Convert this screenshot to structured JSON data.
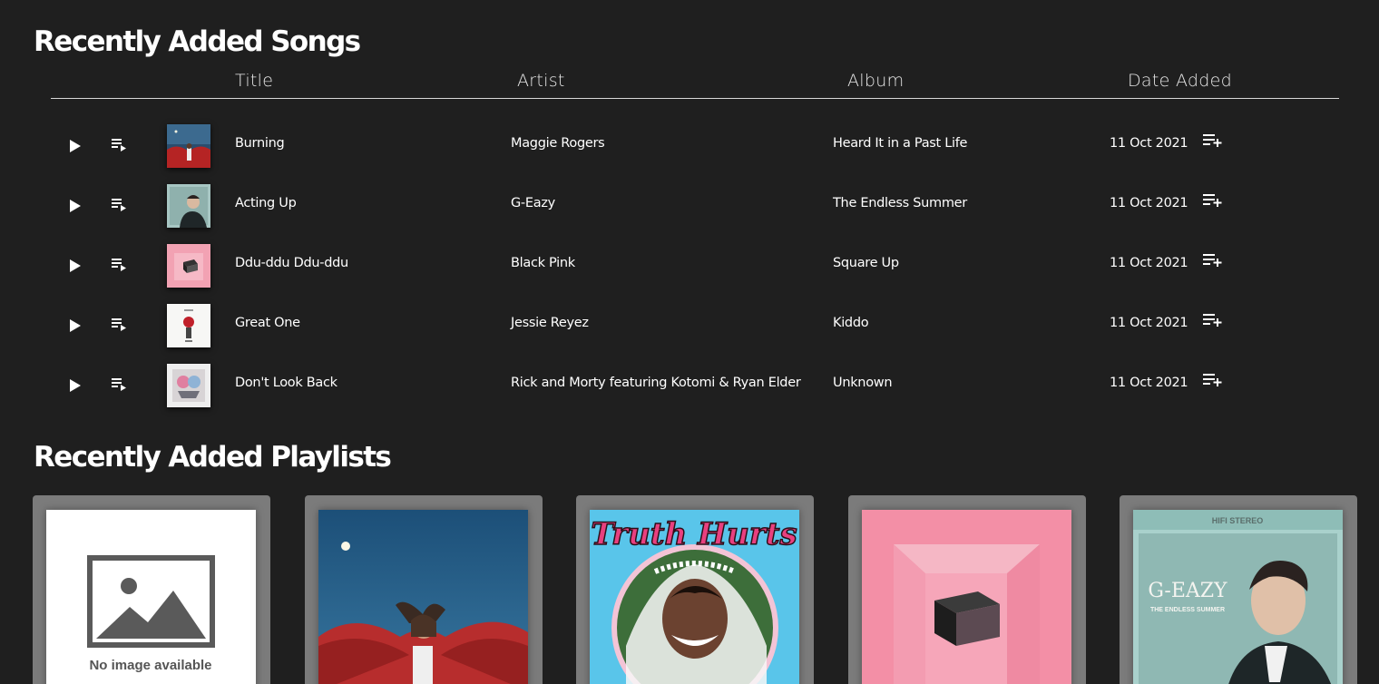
{
  "songs_section": {
    "title": "Recently Added Songs",
    "columns": [
      "Title",
      "Artist",
      "Album",
      "Date Added"
    ],
    "rows": [
      {
        "title": "Burning",
        "artist": "Maggie Rogers",
        "album": "Heard It in a Past Life",
        "date": "11 Oct 2021",
        "cover": "heard-it-cover"
      },
      {
        "title": "Acting Up",
        "artist": "G-Eazy",
        "album": "The Endless Summer",
        "date": "11 Oct 2021",
        "cover": "endless-summer-cover"
      },
      {
        "title": "Ddu-ddu Ddu-ddu",
        "artist": "Black Pink",
        "album": "Square Up",
        "date": "11 Oct 2021",
        "cover": "square-up-cover"
      },
      {
        "title": "Great One",
        "artist": "Jessie Reyez",
        "album": "Kiddo",
        "date": "11 Oct 2021",
        "cover": "kiddo-cover"
      },
      {
        "title": "Don't Look Back",
        "artist": "Rick and Morty featuring Kotomi & Ryan Elder",
        "album": "Unknown",
        "date": "11 Oct 2021",
        "cover": "rick-morty-cover"
      }
    ]
  },
  "playlists_section": {
    "title": "Recently Added Playlists",
    "cards": [
      {
        "image": "no-image-placeholder",
        "placeholder_text": "No image available"
      },
      {
        "image": "maggie-rogers-cover"
      },
      {
        "image": "truth-hurts-cover",
        "cover_text": "Truth Hurts"
      },
      {
        "image": "square-up-cover"
      },
      {
        "image": "g-eazy-cover",
        "cover_text": "G-EAZY",
        "cover_subtext": "THE ENDLESS SUMMER",
        "cover_top": "HIFI STEREO"
      }
    ]
  },
  "colors": {
    "background": "#1f1f1f",
    "card": "#7b7b7b",
    "text": "#ffffff"
  },
  "icons": {
    "play": "play-icon",
    "queue": "queue-music-icon",
    "add_to_playlist": "playlist-add-icon"
  }
}
